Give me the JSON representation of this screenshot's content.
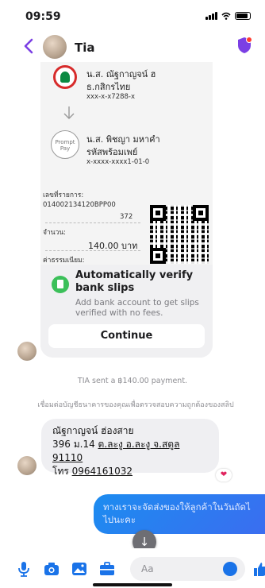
{
  "status_bar": {
    "time": "09:59"
  },
  "header": {
    "name": "Tia"
  },
  "slip": {
    "sender_name": "น.ส. ณัฐกาญจน์ ฮ",
    "sender_bank": "ธ.กสิกรไทย",
    "sender_account": "xxx-x-x7288-x",
    "recipient_name": "น.ส. พิชญา มหาคำ",
    "recipient_label": "รหัสพร้อมเพย์",
    "recipient_account": "x-xxxx-xxxx1-01-0",
    "promptpay_logo_text": "Prompt Pay",
    "ref_label": "เลขที่รายการ:",
    "ref_value": "014002134120BPP00",
    "ref_value_2": "372",
    "amount_label": "จำนวน:",
    "amount_value": "140.00 บาท",
    "fee_label": "ค่าธรรมเนียม:"
  },
  "verify": {
    "title": "Automatically verify bank slips",
    "subtitle": "Add bank account to get slips verified with no fees.",
    "button_label": "Continue"
  },
  "system_messages": {
    "payment": "TIA sent a ฿140.00 payment.",
    "link_bank": "เชื่อมต่อบัญชีธนาคารของคุณเพื่อตรวจสอบความถูกต้องของสลิป"
  },
  "incoming_message": {
    "line1": "ณัฐกาญจน์ ฮ่องสาย",
    "line2_prefix": "396 ม.14 ",
    "line2_link": "ต.ละงู อ.ละงู จ.สตูล 91110",
    "line3_prefix": "โทร ",
    "line3_link": "0964161032",
    "reaction": "❤"
  },
  "outgoing_message": {
    "line1": "ทางเราจะจัดส่งของให้ลูกค้าในวันถัดไ",
    "line2": "ไปนะคะ"
  },
  "composer": {
    "placeholder": "Aa"
  },
  "colors": {
    "accent": "#7b3fe4",
    "messenger_blue": "#1c8cf0",
    "verify_green": "#3cc05a",
    "kbank_green": "#0a8a42"
  }
}
